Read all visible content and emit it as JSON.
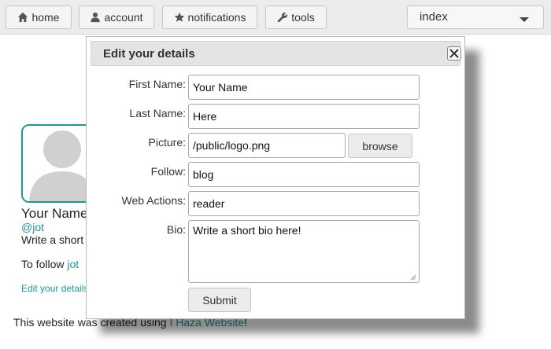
{
  "nav": {
    "home": "home",
    "account": "account",
    "notifications": "notifications",
    "tools": "tools",
    "page_select": "index"
  },
  "profile": {
    "name": "Your Name Here",
    "handle": "@jot",
    "bio": "Write a short bio here!",
    "follow_prefix": "To follow ",
    "follow_link": "jot",
    "edit_link": "Edit your details"
  },
  "footer": {
    "prefix": "This website was created using ",
    "link": "I Haza Website",
    "suffix": "!"
  },
  "dialog": {
    "title": "Edit your details",
    "first_name_label": "First Name:",
    "first_name_value": "Your Name",
    "last_name_label": "Last Name:",
    "last_name_value": "Here",
    "picture_label": "Picture:",
    "picture_value": "/public/logo.png",
    "browse_label": "browse",
    "follow_label": "Follow:",
    "follow_value": "blog",
    "web_actions_label": "Web Actions:",
    "web_actions_value": "reader",
    "bio_label": "Bio:",
    "bio_value": "Write a short bio here!",
    "submit_label": "Submit"
  },
  "colors": {
    "accent": "#1a9a94",
    "topbar": "#ececec",
    "dialog_header": "#e4e4e4"
  }
}
